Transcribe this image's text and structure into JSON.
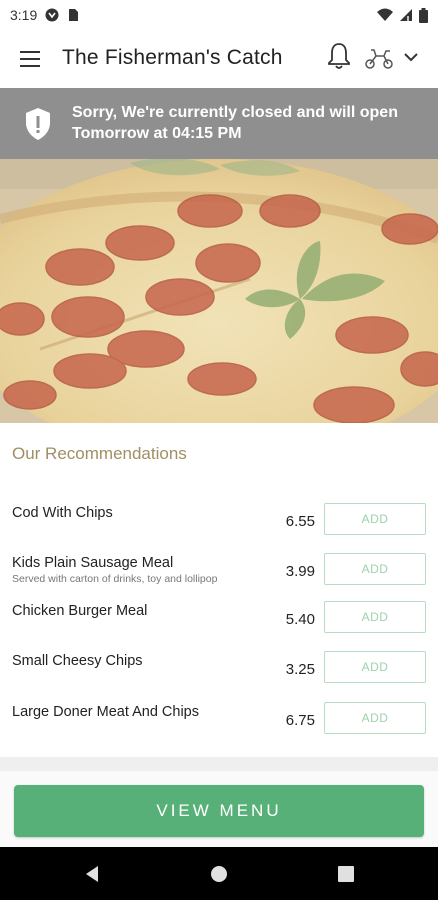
{
  "status_bar": {
    "time": "3:19",
    "icons": [
      "pocket-icon",
      "sim-icon",
      "wifi-icon",
      "signal-icon",
      "battery-icon"
    ]
  },
  "app_bar": {
    "title": "The Fisherman's Catch",
    "icons": [
      "menu-icon",
      "bell-icon",
      "scooter-icon",
      "chevron-down-icon"
    ]
  },
  "banner": {
    "line1": "Sorry, We're currently closed and will open",
    "line2": "Tomorrow at 04:15 PM",
    "icon": "shield-alert-icon",
    "background": "#8f8f8f"
  },
  "hero": {
    "subject": "pepperoni-pizza-image"
  },
  "recommendations": {
    "title": "Our Recommendations",
    "items": [
      {
        "name": "Cod With Chips",
        "description": "",
        "price": "6.55",
        "button": "ADD"
      },
      {
        "name": "Kids Plain Sausage Meal",
        "description": "Served with carton of drinks, toy and lollipop",
        "price": "3.99",
        "button": "ADD"
      },
      {
        "name": "Chicken Burger Meal",
        "description": "",
        "price": "5.40",
        "button": "ADD"
      },
      {
        "name": "Small Cheesy Chips",
        "description": "",
        "price": "3.25",
        "button": "ADD"
      },
      {
        "name": "Large Doner Meat And Chips",
        "description": "",
        "price": "6.75",
        "button": "ADD"
      }
    ]
  },
  "view_menu": {
    "label": "VIEW MENU",
    "color": "#58b079"
  },
  "nav": {
    "buttons": [
      "back-icon",
      "home-icon",
      "recents-icon"
    ]
  },
  "colors": {
    "accent_title": "#a08f63",
    "add_border": "#b6dcc2",
    "add_text": "#9fd0ae"
  }
}
